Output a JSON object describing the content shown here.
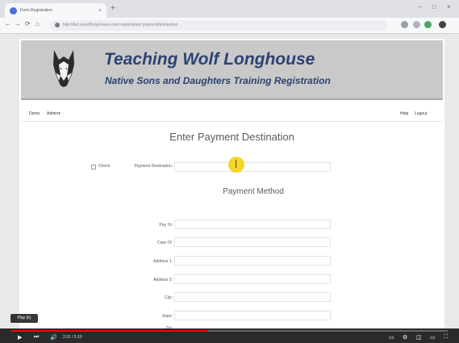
{
  "browser": {
    "tab_title": "Form Registration",
    "tab_close": "×",
    "new_tab": "+",
    "back": "←",
    "forward": "→",
    "reload": "⟳",
    "home": "⌂",
    "url": "http://tw1.tewolflonghouse.com/ registration/ paymentdestination",
    "minimize": "–",
    "maximize": "□",
    "close": "×"
  },
  "header": {
    "title": "Teaching Wolf Longhouse",
    "subtitle": "Native Sons and Daughters Training Registration"
  },
  "menu": {
    "demo": "Demo",
    "admin": "Admin",
    "help": "Help",
    "logout": "Logout"
  },
  "form": {
    "heading": "Enter Payment Destination",
    "payment_destination_label": "Payment Destination:",
    "payment_method_heading": "Payment Method",
    "check_label": "Check",
    "pay_to_label": "Pay To:",
    "care_of_label": "Care Of:",
    "address1_label": "Address 1:",
    "address2_label": "Address 2:",
    "city_label": "City:",
    "state_label": "State:",
    "zip_label": "Zip:"
  },
  "video": {
    "tooltip": "Play (k)",
    "time": "2:31 / 5:10",
    "progress": 0.45,
    "accent_color": "#ff0000"
  },
  "colors": {
    "title_color": "#2c4273",
    "banner_bg": "#c9c9c9"
  }
}
